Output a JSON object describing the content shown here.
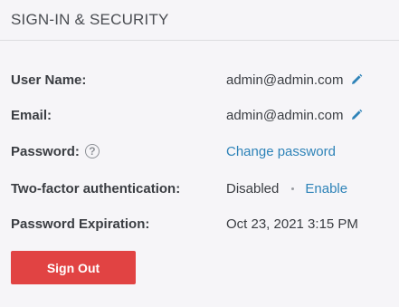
{
  "section": {
    "title": "SIGN-IN & SECURITY"
  },
  "rows": {
    "username": {
      "label": "User Name:",
      "value": "admin@admin.com",
      "edit_icon": "pencil-icon"
    },
    "email": {
      "label": "Email:",
      "value": "admin@admin.com",
      "edit_icon": "pencil-icon"
    },
    "password": {
      "label": "Password:",
      "help_icon_text": "?",
      "link": "Change password"
    },
    "two_factor": {
      "label": "Two-factor authentication:",
      "status": "Disabled",
      "link": "Enable"
    },
    "expiration": {
      "label": "Password Expiration:",
      "value": "Oct 23, 2021 3:15 PM"
    }
  },
  "signout": {
    "label": "Sign Out"
  },
  "colors": {
    "accent_link": "#2e83b8",
    "danger_button": "#e14343",
    "background": "#f6f5f8"
  }
}
